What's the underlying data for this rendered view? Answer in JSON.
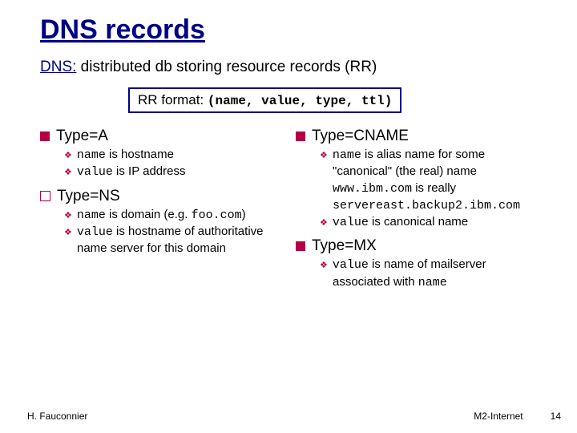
{
  "title": "DNS records",
  "subtitle_prefix": "DNS:",
  "subtitle_rest": " distributed db storing resource records (RR)",
  "rr_label": "RR format: ",
  "rr_tuple": "(name, value, type, ttl)",
  "left": {
    "typeA": {
      "head": "Type=A",
      "pt1a": "name",
      "pt1b": " is hostname",
      "pt2a": "value",
      "pt2b": " is IP address"
    },
    "typeNS": {
      "head": "Type=NS",
      "pt1a": "name",
      "pt1b": " is domain (e.g. ",
      "pt1c": "foo.com",
      "pt1d": ")",
      "pt2a": "value",
      "pt2b": " is hostname of authoritative name server for this domain"
    }
  },
  "right": {
    "typeCNAME": {
      "head": "Type=CNAME",
      "pt1a": "name",
      "pt1b": " is alias name for some \"canonical\" (the real) name",
      "pt1c": "www.ibm.com",
      "pt1d": " is really ",
      "pt1e": "servereast.backup2.ibm.com",
      "pt2a": "value",
      "pt2b": " is canonical name"
    },
    "typeMX": {
      "head": "Type=MX",
      "pt1a": "value",
      "pt1b": " is name of mailserver associated with ",
      "pt1c": "name"
    }
  },
  "footer": {
    "author": "H. Fauconnier",
    "course": "M2-Internet",
    "page": "14"
  }
}
